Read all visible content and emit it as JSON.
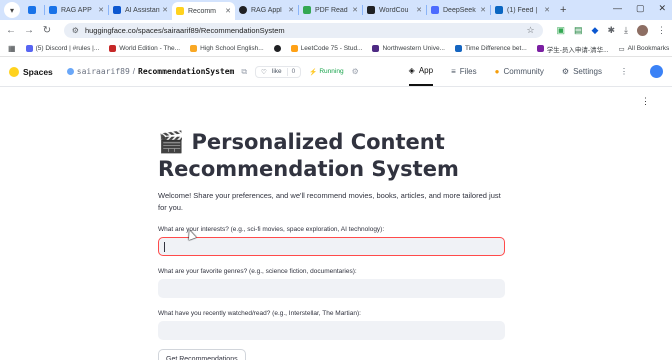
{
  "browser": {
    "tabs": [
      {
        "label": "",
        "color": "#1a73e8"
      },
      {
        "label": "RAG APP",
        "color": "#1a73e8"
      },
      {
        "label": "AI Assistant",
        "color": "#0b57d0"
      },
      {
        "label": "Recomm",
        "color": "#ffd21e"
      },
      {
        "label": "RAG Appl",
        "color": "#202124"
      },
      {
        "label": "PDF Read",
        "color": "#34a853"
      },
      {
        "label": "WordCou",
        "color": "#202124"
      },
      {
        "label": "DeepSeek",
        "color": "#4d6bfe"
      },
      {
        "label": "(1) Feed |",
        "color": "#0a66c2"
      }
    ],
    "url": "huggingface.co/spaces/sairaarif89/RecommendationSystem",
    "bookmarks": [
      {
        "label": "(5) Discord | #rules |...",
        "color": "#5865f2"
      },
      {
        "label": "World Edition - The...",
        "color": "#c62828"
      },
      {
        "label": "High School English...",
        "color": "#f9a825"
      },
      {
        "label": "",
        "color": "#202124"
      },
      {
        "label": "LeetCode 75 - Stud...",
        "color": "#ffa116"
      },
      {
        "label": "Northwestern Unive...",
        "color": "#4e2a84"
      },
      {
        "label": "Time Difference bet...",
        "color": "#1565c0"
      },
      {
        "label": "学生-员入申请-清华...",
        "color": "#7b1fa2"
      }
    ],
    "all_bookmarks": "All Bookmarks"
  },
  "hf": {
    "spaces_label": "Spaces",
    "owner": "sairaarif89",
    "repo_name": "RecommendationSystem",
    "like_label": "like",
    "like_count": "0",
    "status": "Running",
    "nav": {
      "app": "App",
      "files": "Files",
      "community": "Community",
      "settings": "Settings"
    }
  },
  "app": {
    "title_emoji": "🎬",
    "title": "Personalized Content Recommendation System",
    "intro": "Welcome! Share your preferences, and we'll recommend movies, books, articles, and more tailored just for you.",
    "fields": [
      {
        "label": "What are your interests? (e.g., sci-fi movies, space exploration, AI technology):",
        "value": ""
      },
      {
        "label": "What are your favorite genres? (e.g., science fiction, documentaries):",
        "value": ""
      },
      {
        "label": "What have you recently watched/read? (e.g., Interstellar, The Martian):",
        "value": ""
      }
    ],
    "button": "Get Recommendations"
  }
}
